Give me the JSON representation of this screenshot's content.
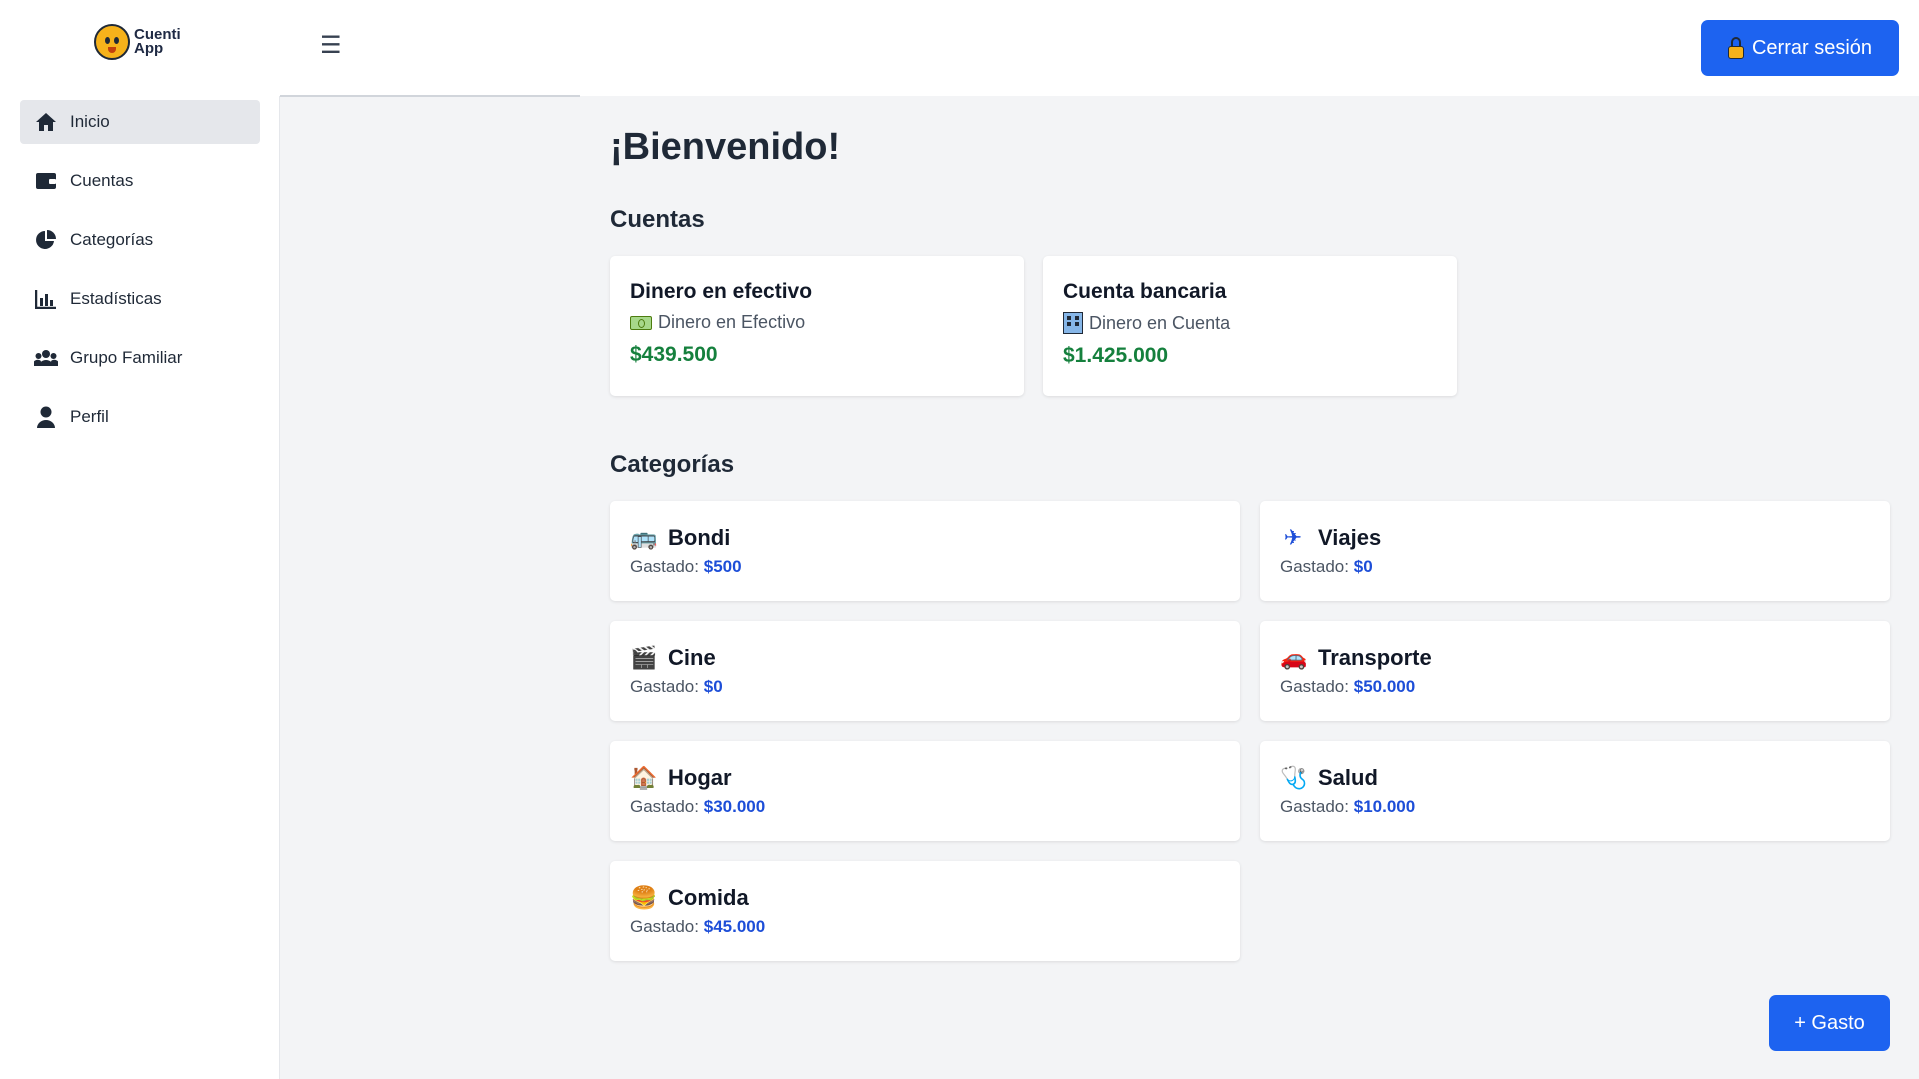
{
  "header": {
    "logo_text_line1": "Cuenti",
    "logo_text_line2": "App",
    "menu_toggle": "☰",
    "logout_label": "Cerrar sesión"
  },
  "sidebar": {
    "items": [
      {
        "label": "Inicio",
        "icon": "home-icon",
        "active": true
      },
      {
        "label": "Cuentas",
        "icon": "wallet-icon",
        "active": false
      },
      {
        "label": "Categorías",
        "icon": "pie-chart-icon",
        "active": false
      },
      {
        "label": "Estadísticas",
        "icon": "bar-chart-icon",
        "active": false
      },
      {
        "label": "Grupo Familiar",
        "icon": "users-icon",
        "active": false
      },
      {
        "label": "Perfil",
        "icon": "user-icon",
        "active": false
      }
    ]
  },
  "main": {
    "welcome": "¡Bienvenido!",
    "accounts_title": "Cuentas",
    "accounts": [
      {
        "name": "Dinero en efectivo",
        "type": "Dinero en Efectivo",
        "icon": "cash-icon",
        "balance": "$439.500"
      },
      {
        "name": "Cuenta bancaria",
        "type": "Dinero en Cuenta",
        "icon": "bank-icon",
        "balance": "$1.425.000"
      }
    ],
    "categories_title": "Categorías",
    "spent_label": "Gastado:",
    "categories": [
      {
        "name": "Bondi",
        "icon": "bus-icon",
        "glyph": "🚌",
        "spent": "$500"
      },
      {
        "name": "Viajes",
        "icon": "airplane-icon",
        "glyph": "✈",
        "spent": "$0"
      },
      {
        "name": "Cine",
        "icon": "clapperboard-icon",
        "glyph": "🎬",
        "spent": "$0"
      },
      {
        "name": "Transporte",
        "icon": "car-icon",
        "glyph": "🚗",
        "spent": "$50.000"
      },
      {
        "name": "Hogar",
        "icon": "house-icon",
        "glyph": "🏠",
        "spent": "$30.000"
      },
      {
        "name": "Salud",
        "icon": "stethoscope-icon",
        "glyph": "🩺",
        "spent": "$10.000"
      },
      {
        "name": "Comida",
        "icon": "burger-icon",
        "glyph": "🍔",
        "spent": "$45.000"
      }
    ],
    "add_expense_label": "+ Gasto"
  },
  "colors": {
    "primary": "#1d63f0",
    "balance_green": "#15803d",
    "spent_blue": "#1d4ed8",
    "background": "#f3f4f6"
  }
}
